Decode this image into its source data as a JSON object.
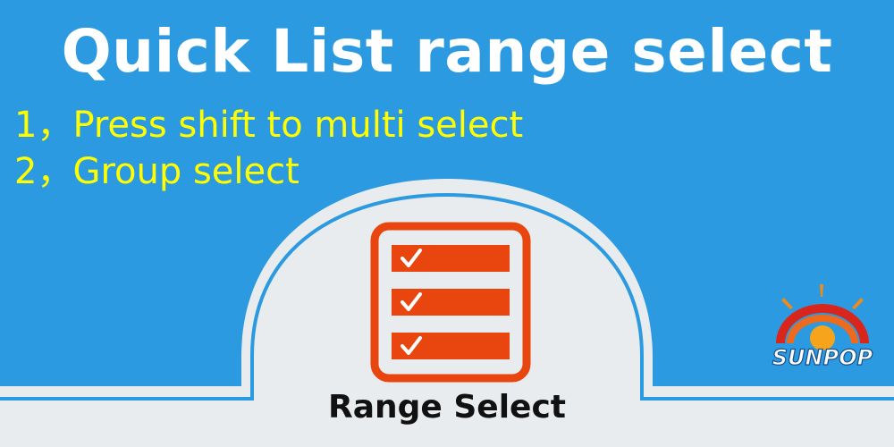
{
  "banner": {
    "title": "Quick List range select",
    "features": [
      "1，Press shift to multi select",
      "2，Group select"
    ],
    "caption": "Range Select"
  },
  "icon": {
    "name": "checklist-icon",
    "checked_items": 3
  },
  "logo": {
    "text": "SUNPOP"
  },
  "colors": {
    "background": "#2b9ae0",
    "panel": "#e9ecee",
    "title": "#ffffff",
    "features": "#ffff00",
    "icon_accent": "#e8450f",
    "caption": "#111111"
  }
}
